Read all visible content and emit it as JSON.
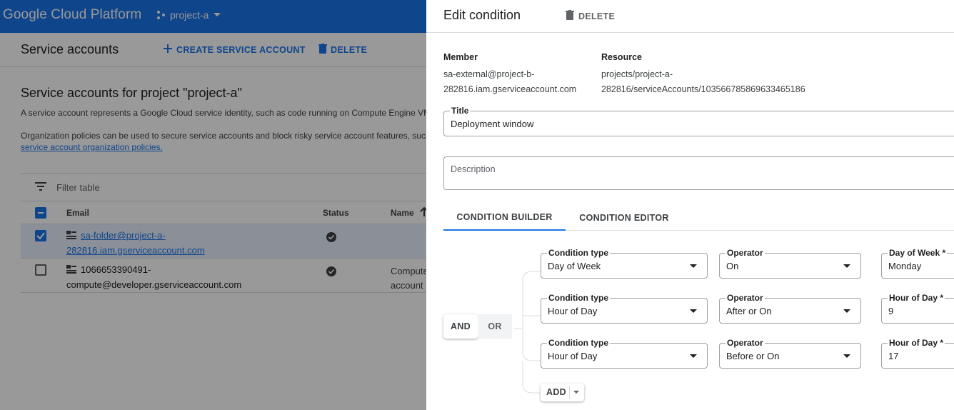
{
  "topbar": {
    "brand": "Google Cloud Platform",
    "project": "project-a"
  },
  "subbar": {
    "title": "Service accounts",
    "create_label": "CREATE SERVICE ACCOUNT",
    "delete_label": "DELETE"
  },
  "main": {
    "heading": "Service accounts for project \"project-a\"",
    "desc1": "A service account represents a Google Cloud service identity, such as code running on Compute Engine VM",
    "desc2": "Organization policies can be used to secure service accounts and block risky service account features, such",
    "link": "service account organization policies.",
    "filter_placeholder": "Filter table",
    "columns": [
      "Email",
      "Status",
      "Name"
    ],
    "rows": [
      {
        "email_line1": "sa-folder@project-a-",
        "email_line2": "282816.iam.gserviceaccount.com",
        "name_line1": "",
        "name_line2": "",
        "selected": true
      },
      {
        "email_line1": "1066653390491-",
        "email_line2": "compute@developer.gserviceaccount.com",
        "name_line1": "Compute",
        "name_line2": "account",
        "selected": false
      }
    ]
  },
  "panel": {
    "title": "Edit condition",
    "delete_label": "DELETE",
    "member_label": "Member",
    "member_line1": "sa-external@project-b-",
    "member_line2": "282816.iam.gserviceaccount.com",
    "resource_label": "Resource",
    "resource_line1": "projects/project-a-",
    "resource_line2": "282816/serviceAccounts/103566785869633465186",
    "title_field_label": "Title",
    "title_field_value": "Deployment window",
    "description_placeholder": "Description",
    "tabs": [
      "CONDITION BUILDER",
      "CONDITION EDITOR"
    ],
    "and_label": "AND",
    "or_label": "OR",
    "add_label": "ADD",
    "conditions": [
      {
        "type_label": "Condition type",
        "type_value": "Day of Week",
        "op_label": "Operator",
        "op_value": "On",
        "val_label": "Day of Week *",
        "val_value": "Monday"
      },
      {
        "type_label": "Condition type",
        "type_value": "Hour of Day",
        "op_label": "Operator",
        "op_value": "After or On",
        "val_label": "Hour of Day *",
        "val_value": "9"
      },
      {
        "type_label": "Condition type",
        "type_value": "Hour of Day",
        "op_label": "Operator",
        "op_value": "Before or On",
        "val_label": "Hour of Day *",
        "val_value": "17"
      }
    ]
  },
  "colors": {
    "brand_blue": "#1a73e8",
    "overlay": "rgba(0,0,0,0.40)"
  }
}
